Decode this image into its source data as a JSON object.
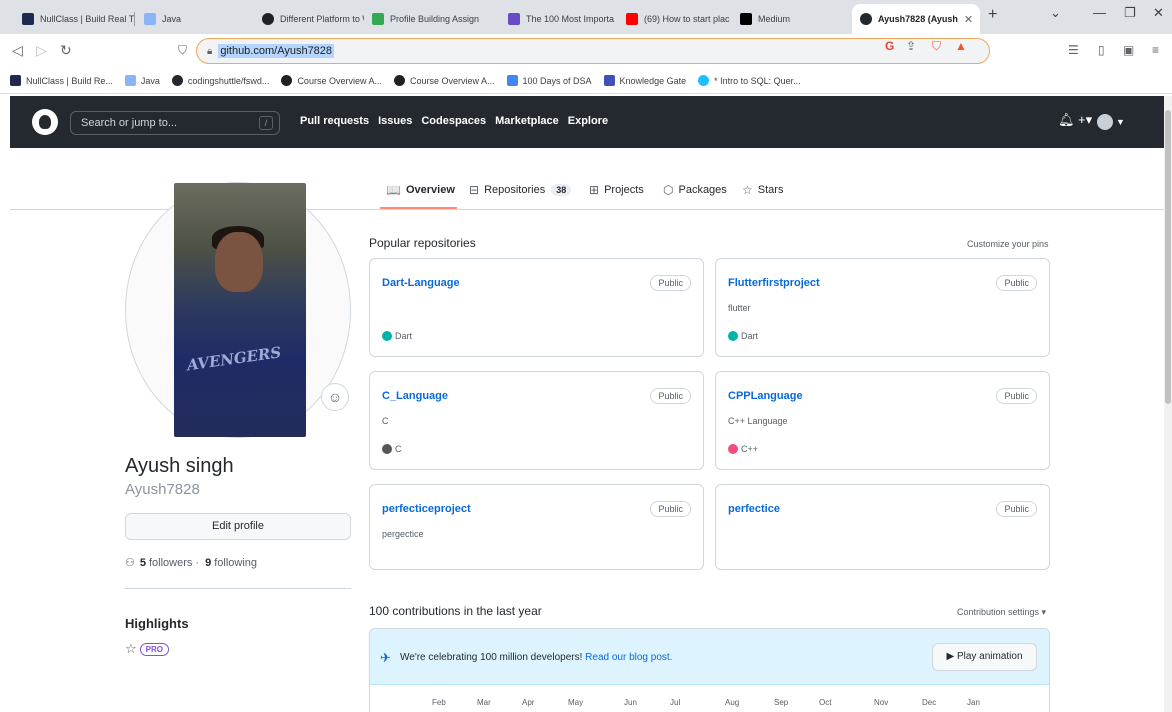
{
  "browser": {
    "tabs": [
      {
        "label": "NullClass | Build Real T",
        "color": "#1b2a4e"
      },
      {
        "label": "Java",
        "color": "#8ab4f8"
      },
      {
        "label": "Different Platform to W",
        "color": "#202124"
      },
      {
        "label": "Profile Building Assign",
        "color": "#34a853"
      },
      {
        "label": "The 100 Most Importa",
        "color": "#6a4bc4"
      },
      {
        "label": "(69) How to start plac",
        "color": "#ff0000"
      },
      {
        "label": "Medium",
        "color": "#000000"
      },
      {
        "label": "Ayush7828 (Ayush",
        "color": "#24292f"
      }
    ],
    "close_glyph": "✕",
    "new_tab_glyph": "+",
    "url": "github.com/Ayush7828",
    "bookmarks": [
      {
        "label": "NullClass | Build Re...",
        "color": "#1b2a4e"
      },
      {
        "label": "Java",
        "color": "#8ab4f8"
      },
      {
        "label": "codingshuttle/fswd...",
        "color": "#24292f"
      },
      {
        "label": "Course Overview A...",
        "color": "#202124"
      },
      {
        "label": "Course Overview A...",
        "color": "#202124"
      },
      {
        "label": "100 Days of DSA",
        "color": "#4285f4"
      },
      {
        "label": "Knowledge Gate",
        "color": "#3f51b5"
      },
      {
        "label": "* Intro to SQL: Quer...",
        "color": "#20beff"
      }
    ]
  },
  "github": {
    "search_placeholder": "Search or jump to...",
    "search_shortcut": "/",
    "nav": [
      "Pull requests",
      "Issues",
      "Codespaces",
      "Marketplace",
      "Explore"
    ],
    "profile_tabs": [
      {
        "label": "Overview",
        "icon": "book-icon",
        "glyph": "📖"
      },
      {
        "label": "Repositories",
        "icon": "repo-icon",
        "glyph": "⊟",
        "count": "38"
      },
      {
        "label": "Projects",
        "icon": "project-icon",
        "glyph": "⊞"
      },
      {
        "label": "Packages",
        "icon": "package-icon",
        "glyph": "⬡"
      },
      {
        "label": "Stars",
        "icon": "star-icon",
        "glyph": "☆"
      }
    ],
    "profile": {
      "avatar_text": "AVENGERS",
      "name": "Ayush singh",
      "username": "Ayush7828",
      "edit_label": "Edit profile",
      "followers_count": "5",
      "followers_label": "followers",
      "separator": "·",
      "following_count": "9",
      "following_label": "following",
      "highlights_title": "Highlights",
      "pro_label": "PRO"
    },
    "popular": {
      "title": "Popular repositories",
      "customize": "Customize your pins",
      "repos": [
        {
          "name": "Dart-Language",
          "visibility": "Public",
          "desc": "",
          "lang": "Dart",
          "lang_color": "#00b4ab"
        },
        {
          "name": "Flutterfirstproject",
          "visibility": "Public",
          "desc": "flutter",
          "lang": "Dart",
          "lang_color": "#00b4ab"
        },
        {
          "name": "C_Language",
          "visibility": "Public",
          "desc": "C",
          "lang": "C",
          "lang_color": "#555555"
        },
        {
          "name": "CPPLanguage",
          "visibility": "Public",
          "desc": "C++ Language",
          "lang": "C++",
          "lang_color": "#f34b7d"
        },
        {
          "name": "perfecticeproject",
          "visibility": "Public",
          "desc": "pergectice",
          "lang": "",
          "lang_color": ""
        },
        {
          "name": "perfectice",
          "visibility": "Public",
          "desc": "",
          "lang": "",
          "lang_color": ""
        }
      ]
    },
    "contributions": {
      "title": "100 contributions in the last year",
      "settings": "Contribution settings ▾",
      "celebrate_text": "We're celebrating 100 million developers!",
      "celebrate_link": "Read our blog post.",
      "play_label": "▶ Play animation",
      "months": [
        "Feb",
        "Mar",
        "Apr",
        "May",
        "Jun",
        "Jul",
        "Aug",
        "Sep",
        "Oct",
        "Nov",
        "Dec",
        "Jan"
      ]
    }
  }
}
